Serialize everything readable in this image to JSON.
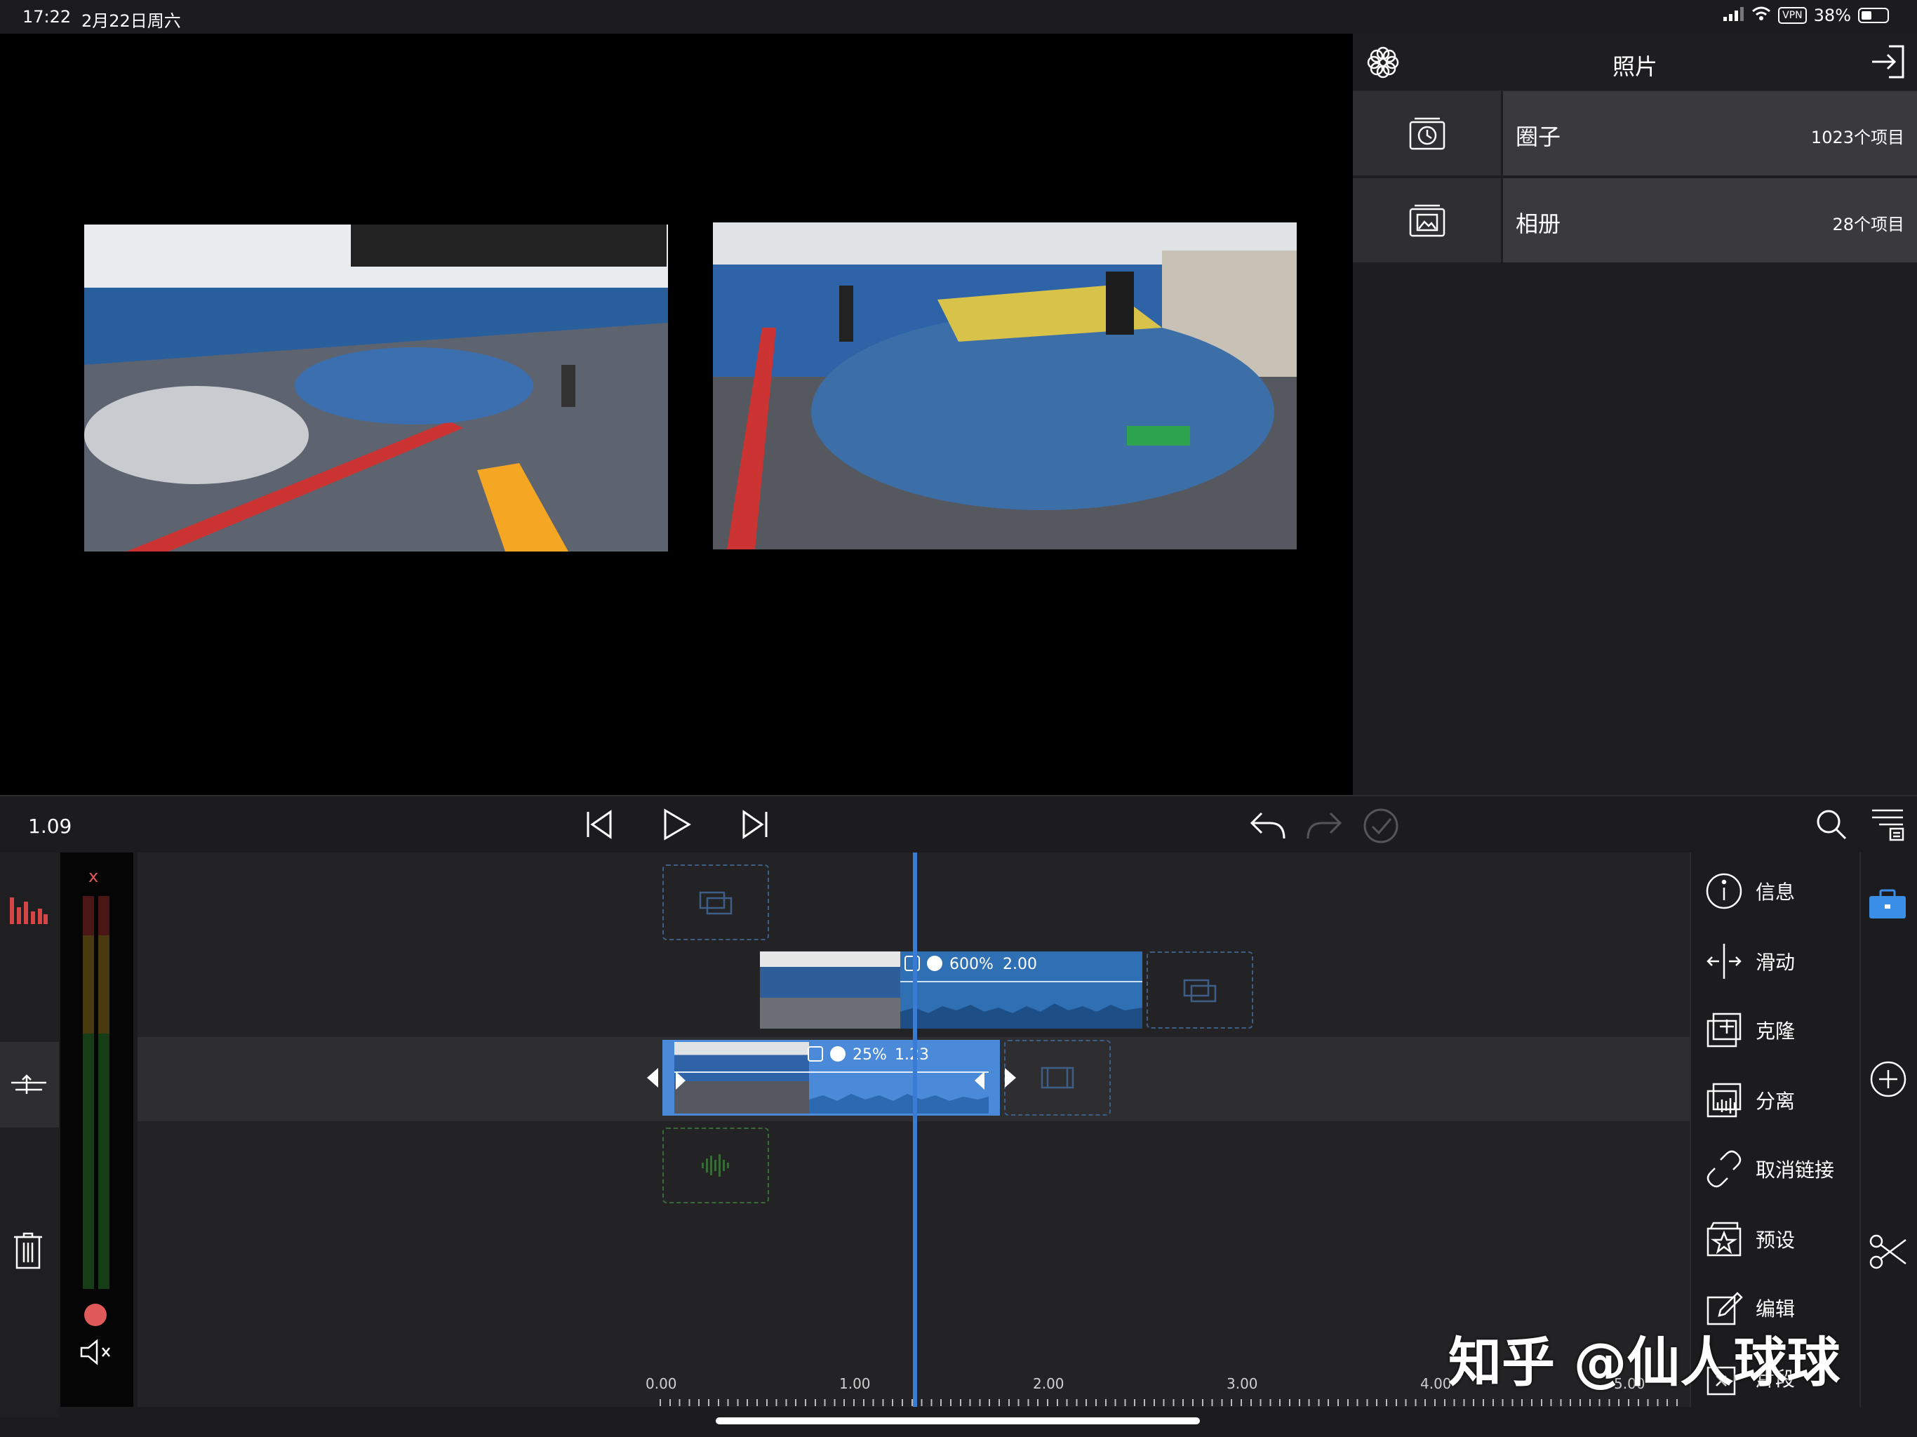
{
  "status_bar": {
    "time": "17:22",
    "date": "2月22日周六",
    "vpn": "VPN",
    "battery": "38%"
  },
  "library": {
    "title": "照片",
    "rows": [
      {
        "label": "圈子",
        "count": "1023个项目",
        "icon": "clock-album-icon"
      },
      {
        "label": "相册",
        "count": "28个项目",
        "icon": "photo-album-icon"
      }
    ]
  },
  "transport": {
    "position": "1.09"
  },
  "timeline": {
    "meter_close": "x",
    "clip_top": {
      "speed": "600%",
      "duration": "2.00"
    },
    "clip_main": {
      "speed": "25%",
      "duration": "1.23"
    },
    "ruler": [
      "0.00",
      "1.00",
      "2.00",
      "3.00",
      "4.00",
      "5.00"
    ]
  },
  "tools": [
    {
      "label": "信息",
      "icon": "info-icon"
    },
    {
      "label": "滑动",
      "icon": "slide-icon"
    },
    {
      "label": "克隆",
      "icon": "clone-icon"
    },
    {
      "label": "分离",
      "icon": "detach-audio-icon"
    },
    {
      "label": "取消链接",
      "icon": "unlink-icon"
    },
    {
      "label": "预设",
      "icon": "preset-star-icon"
    },
    {
      "label": "编辑",
      "icon": "edit-pencil-icon"
    },
    {
      "label": "片段",
      "icon": "segment-icon"
    }
  ],
  "watermark": "知乎 @仙人球球",
  "colors": {
    "accent_blue": "#2f6fb4",
    "playhead": "#3a7bd5",
    "meter_red": "#e05a5a"
  }
}
